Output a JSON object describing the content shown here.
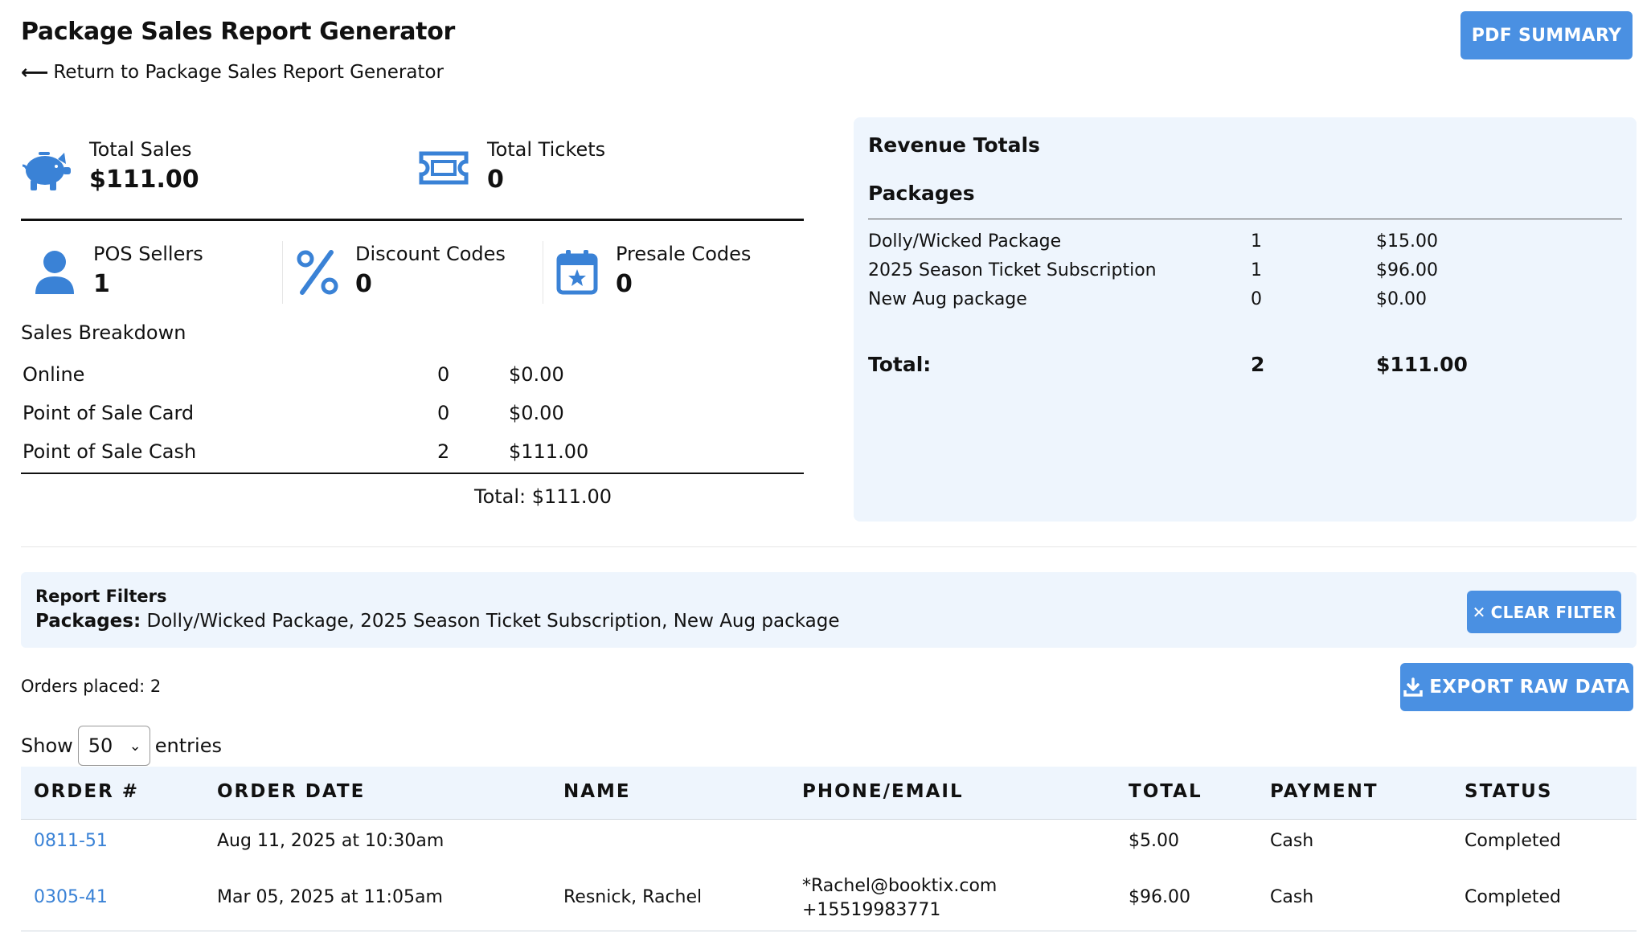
{
  "header": {
    "title": "Package Sales Report Generator",
    "back_link": "Return to Package Sales Report Generator",
    "pdf_button": "PDF SUMMARY"
  },
  "summary": {
    "total_sales_label": "Total Sales",
    "total_sales_value": "$111.00",
    "total_tickets_label": "Total Tickets",
    "total_tickets_value": "0",
    "pos_sellers_label": "POS Sellers",
    "pos_sellers_value": "1",
    "discount_codes_label": "Discount Codes",
    "discount_codes_value": "0",
    "presale_codes_label": "Presale Codes",
    "presale_codes_value": "0"
  },
  "breakdown": {
    "title": "Sales Breakdown",
    "rows": [
      {
        "label": "Online",
        "count": "0",
        "amount": "$0.00"
      },
      {
        "label": "Point of Sale Card",
        "count": "0",
        "amount": "$0.00"
      },
      {
        "label": "Point of Sale Cash",
        "count": "2",
        "amount": "$111.00"
      }
    ],
    "total": "Total: $111.00"
  },
  "revenue": {
    "title": "Revenue Totals",
    "subtitle": "Packages",
    "rows": [
      {
        "name": "Dolly/Wicked Package",
        "count": "1",
        "amount": "$15.00"
      },
      {
        "name": "2025 Season Ticket Subscription",
        "count": "1",
        "amount": "$96.00"
      },
      {
        "name": "New Aug package",
        "count": "0",
        "amount": "$0.00"
      }
    ],
    "total_label": "Total:",
    "total_count": "2",
    "total_amount": "$111.00"
  },
  "filters": {
    "title": "Report Filters",
    "packages_label": "Packages:",
    "packages_value": "Dolly/Wicked Package, 2025 Season Ticket Subscription, New Aug package",
    "clear_button": "CLEAR FILTER"
  },
  "orders": {
    "placed_text": "Orders placed: 2",
    "export_button": "EXPORT RAW DATA",
    "show_label": "Show",
    "entries_value": "50",
    "entries_label": "entries",
    "columns": [
      "ORDER #",
      "ORDER DATE",
      "NAME",
      "PHONE/EMAIL",
      "TOTAL",
      "PAYMENT",
      "STATUS"
    ],
    "rows": [
      {
        "order": "0811-51",
        "date": "Aug 11, 2025 at 10:30am",
        "name": "",
        "email": "",
        "phone": "",
        "total": "$5.00",
        "payment": "Cash",
        "status": "Completed"
      },
      {
        "order": "0305-41",
        "date": "Mar 05, 2025 at 11:05am",
        "name": "Resnick, Rachel",
        "email": "*Rachel@booktix.com",
        "phone": "+15519983771",
        "total": "$96.00",
        "payment": "Cash",
        "status": "Completed"
      }
    ]
  },
  "colors": {
    "accent": "#4a90e2",
    "panel_bg": "#eef5fd",
    "link": "#3a82d6"
  }
}
